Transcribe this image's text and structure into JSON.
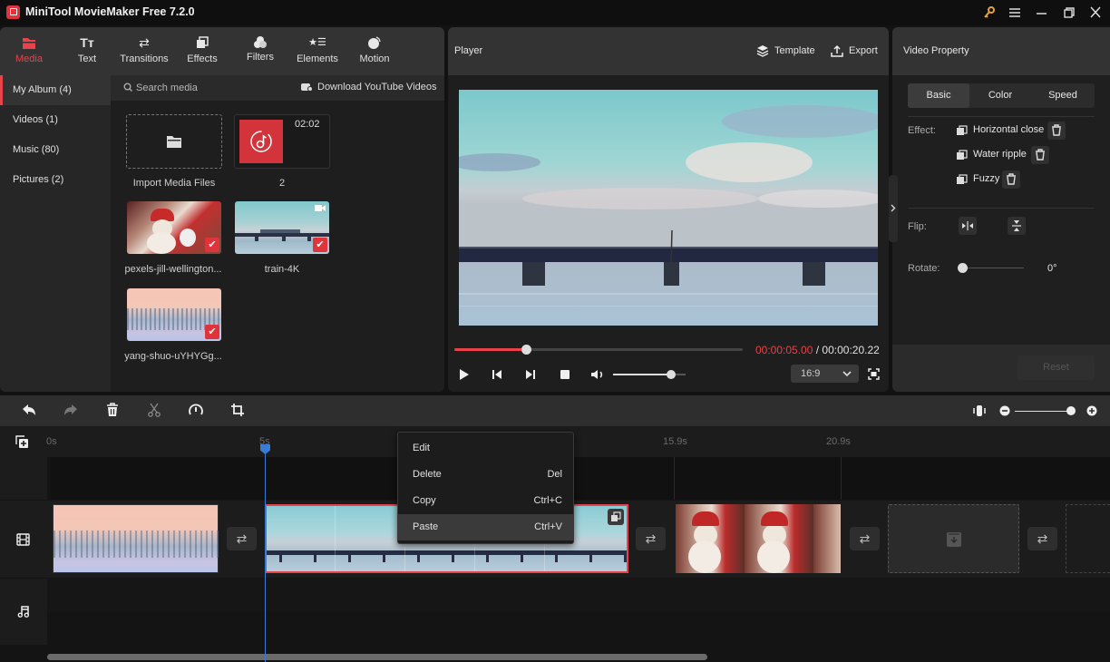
{
  "app": {
    "title": "MiniTool MovieMaker Free 7.2.0"
  },
  "window_controls": {
    "key": "key-icon",
    "menu": "menu-icon",
    "minimize": "minimize-icon",
    "restore": "restore-icon",
    "close": "close-icon"
  },
  "toolbar_tabs": [
    {
      "label": "Media",
      "icon": "folder-icon",
      "active": true
    },
    {
      "label": "Text",
      "icon": "text-icon"
    },
    {
      "label": "Transitions",
      "icon": "transitions-icon"
    },
    {
      "label": "Effects",
      "icon": "effects-icon"
    },
    {
      "label": "Filters",
      "icon": "filters-icon"
    },
    {
      "label": "Elements",
      "icon": "elements-icon"
    },
    {
      "label": "Motion",
      "icon": "motion-icon"
    }
  ],
  "album_nav": [
    {
      "label": "My Album (4)",
      "active": true
    },
    {
      "label": "Videos (1)"
    },
    {
      "label": "Music (80)"
    },
    {
      "label": "Pictures (2)"
    }
  ],
  "media": {
    "search_placeholder": "Search media",
    "download_label": "Download YouTube Videos",
    "import_label": "Import Media Files",
    "items": [
      {
        "name": "2",
        "type": "music",
        "duration": "02:02"
      },
      {
        "name": "pexels-jill-wellington...",
        "type": "picture",
        "checked": true
      },
      {
        "name": "train-4K",
        "type": "video",
        "checked": true
      },
      {
        "name": "yang-shuo-uYHYGg...",
        "type": "picture",
        "checked": true
      }
    ]
  },
  "player": {
    "title": "Player",
    "template_label": "Template",
    "export_label": "Export",
    "current_time": "00:00:05.00",
    "separator": " / ",
    "total_time": "00:00:20.22",
    "progress": 0.247,
    "volume": 0.8,
    "aspect_ratio": "16:9",
    "accent": "#e8434b"
  },
  "property": {
    "title": "Video Property",
    "tabs": [
      "Basic",
      "Color",
      "Speed"
    ],
    "active_tab": "Basic",
    "effect_label": "Effect:",
    "effects": [
      "Horizontal close",
      "Water ripple",
      "Fuzzy"
    ],
    "flip_label": "Flip:",
    "rotate_label": "Rotate:",
    "rotate_value": "0°",
    "reset_label": "Reset"
  },
  "timeline": {
    "tools": [
      "undo-icon",
      "redo-icon",
      "delete-icon",
      "split-icon",
      "speed-icon",
      "crop-icon"
    ],
    "ticks": [
      "0s",
      "5s",
      "15.9s",
      "20.9s"
    ],
    "zoom_level": 1.0,
    "playhead_time": "5s"
  },
  "context_menu": [
    {
      "label": "Edit",
      "shortcut": ""
    },
    {
      "label": "Delete",
      "shortcut": "Del"
    },
    {
      "label": "Copy",
      "shortcut": "Ctrl+C"
    },
    {
      "label": "Paste",
      "shortcut": "Ctrl+V",
      "highlighted": true
    }
  ]
}
